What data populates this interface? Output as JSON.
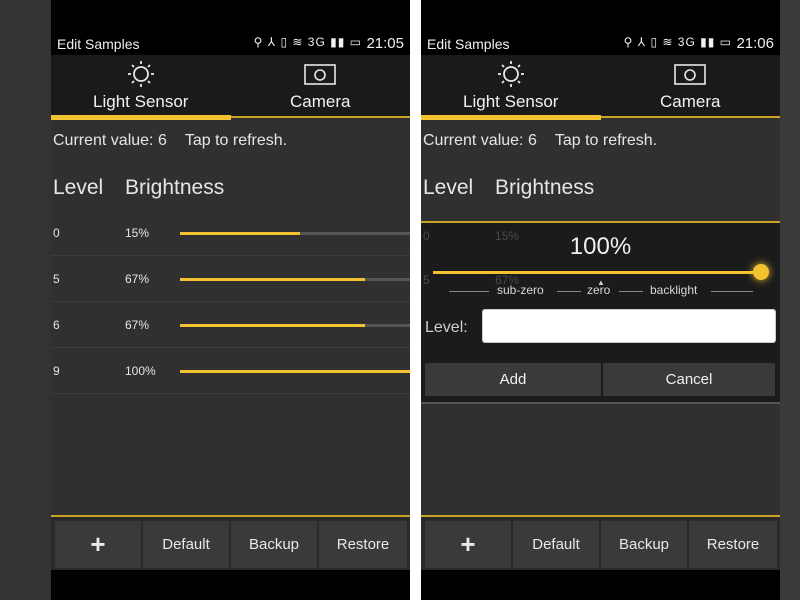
{
  "colors": {
    "accent": "#f2c230",
    "background": "#303030",
    "statusbar": "#000000",
    "tabbar": "#1a1a1a"
  },
  "status_bar": {
    "app_title": "Edit Samples",
    "icons_text": "⚲ ⅄ ▯ ≋ 3G ▮▮ ▭",
    "icon_names": [
      "usb-icon",
      "usb-debug-icon",
      "vibrate-icon",
      "wifi-icon",
      "signal-3g-icon",
      "battery-icon"
    ]
  },
  "tabs": [
    {
      "label": "Light Sensor",
      "icon": "sun-icon",
      "active": true
    },
    {
      "label": "Camera",
      "icon": "camera-icon",
      "active": false
    }
  ],
  "left_screen": {
    "clock": "21:05",
    "current_value": "Current value: 6",
    "tap_hint": "Tap to refresh.",
    "headers": {
      "level": "Level",
      "brightness": "Brightness"
    },
    "rows": [
      {
        "level": "0",
        "brightness": "15%",
        "fill": 0.5
      },
      {
        "level": "5",
        "brightness": "67%",
        "fill": 0.77
      },
      {
        "level": "6",
        "brightness": "67%",
        "fill": 0.77
      },
      {
        "level": "9",
        "brightness": "100%",
        "fill": 1.0
      }
    ]
  },
  "right_screen": {
    "clock": "21:06",
    "current_value": "Current value: 6",
    "tap_hint": "Tap to refresh.",
    "headers": {
      "level": "Level",
      "brightness": "Brightness"
    },
    "dialog": {
      "value": "100%",
      "slider_value": 1.0,
      "scale": {
        "sub_zero": "sub-zero",
        "zero": "zero",
        "backlight": "backlight"
      },
      "level_label": "Level:",
      "level_value": "",
      "add_label": "Add",
      "cancel_label": "Cancel",
      "ghost_level_0": "0",
      "ghost_pct_0": "15%",
      "ghost_level_5": "5",
      "ghost_pct_5": "67%"
    }
  },
  "bottom_bar": {
    "add_label": "+",
    "default_label": "Default",
    "backup_label": "Backup",
    "restore_label": "Restore"
  }
}
